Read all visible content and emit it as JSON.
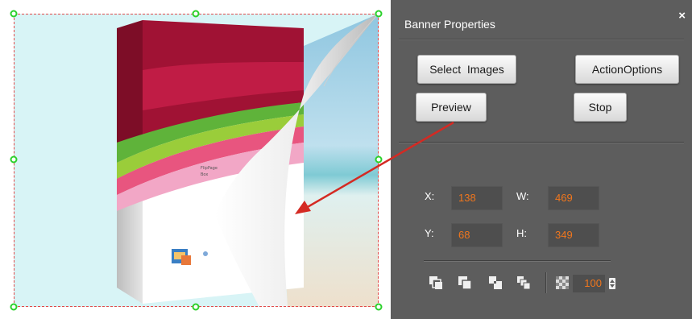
{
  "panel": {
    "title": "Banner Properties",
    "close_glyph": "×",
    "buttons": {
      "select_images": "Select  Images",
      "action_options": "ActionOptions",
      "preview": "Preview",
      "stop": "Stop"
    },
    "position": {
      "x_label": "X:",
      "x_value": "138",
      "w_label": "W:",
      "w_value": "469",
      "y_label": "Y:",
      "y_value": "68",
      "h_label": "H:",
      "h_value": "349"
    },
    "toolbar": {
      "icons": [
        "bring-to-front-icon",
        "send-to-back-icon",
        "bring-forward-icon",
        "send-backward-icon",
        "opacity-icon"
      ],
      "opacity_value": "100"
    }
  },
  "canvas": {
    "product_box_text": [
      "FlipPage",
      "Box"
    ]
  },
  "colors": {
    "panel_bg": "#5d5d5d",
    "value_text": "#f0761d",
    "selection_border": "#e24a4a",
    "handle": "#2bd12b",
    "annotation_arrow": "#d42a23"
  }
}
